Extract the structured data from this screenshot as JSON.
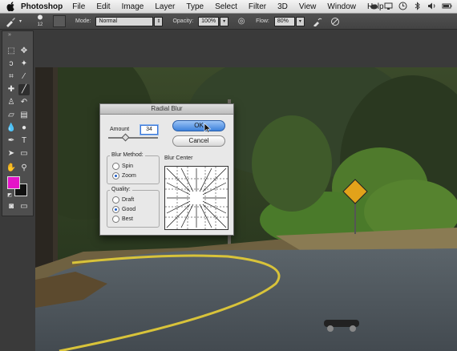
{
  "menubar": {
    "app_name": "Photoshop",
    "menus": [
      "File",
      "Edit",
      "Image",
      "Layer",
      "Type",
      "Select",
      "Filter",
      "3D",
      "View",
      "Window",
      "Help"
    ]
  },
  "options_bar": {
    "brush_size": "12",
    "mode_label": "Mode:",
    "mode_value": "Normal",
    "opacity_label": "Opacity:",
    "opacity_value": "100%",
    "flow_label": "Flow:",
    "flow_value": "80%"
  },
  "colors": {
    "foreground": "#e514c8",
    "background": "#111111",
    "ok_button": "#3d82dc"
  },
  "dialog": {
    "title": "Radial Blur",
    "amount_label": "Amount",
    "amount_value": "34",
    "amount_level": 0.34,
    "ok_label": "OK",
    "cancel_label": "Cancel",
    "blur_method_label": "Blur Method:",
    "blur_methods": [
      "Spin",
      "Zoom"
    ],
    "blur_method_selected": "Zoom",
    "quality_label": "Quality:",
    "qualities": [
      "Draft",
      "Good",
      "Best"
    ],
    "quality_selected": "Good",
    "blur_center_label": "Blur Center"
  },
  "icons": {
    "apple": "apple-icon",
    "brush": "brush-icon",
    "airbrush": "airbrush-icon",
    "pressure": "pressure-icon"
  }
}
